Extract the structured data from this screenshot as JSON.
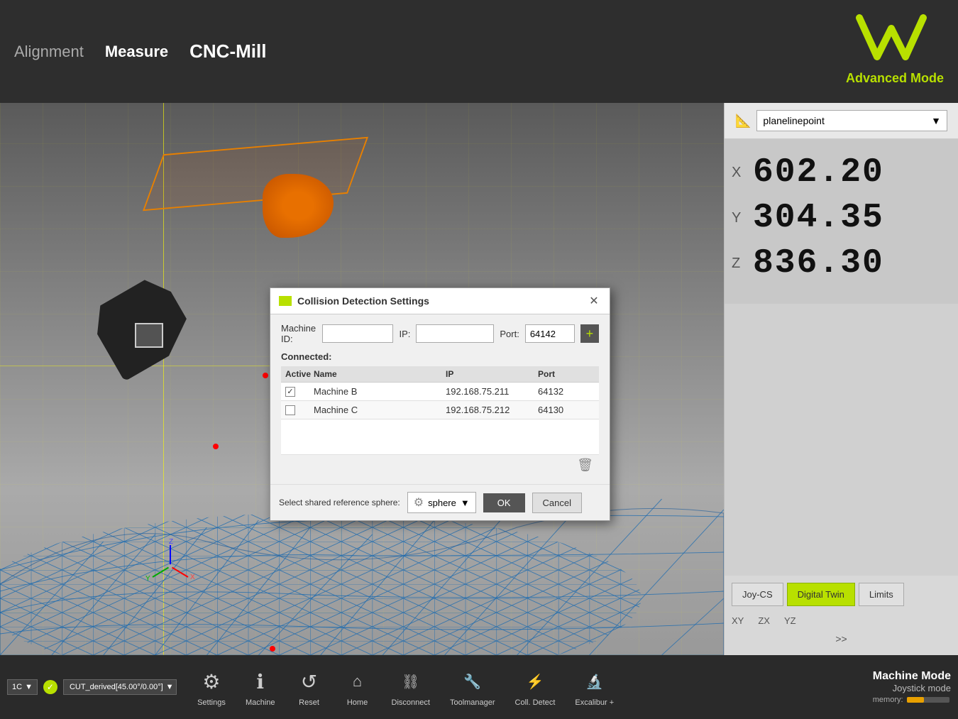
{
  "header": {
    "nav_alignment": "Alignment",
    "nav_measure": "Measure",
    "nav_cnc": "CNC-Mill",
    "advanced_mode_label": "Advanced Mode"
  },
  "right_panel": {
    "dropdown_value": "planelinepoint",
    "coords": {
      "x_label": "X",
      "x_value": "602.20",
      "y_label": "Y",
      "y_value": "304.35",
      "z_label": "Z",
      "z_value": "836.30"
    },
    "btn_joy_cs": "Joy-CS",
    "btn_digital_twin": "Digital Twin",
    "btn_limits": "Limits",
    "coord_xy": "XY",
    "coord_zx": "ZX",
    "coord_yz": "YZ",
    "more": ">>"
  },
  "dialog": {
    "title": "Collision Detection Settings",
    "machine_id_label": "Machine ID:",
    "ip_label": "IP:",
    "port_label": "Port:",
    "port_value": "64142",
    "connected_label": "Connected:",
    "table_headers": {
      "active": "Active",
      "name": "Name",
      "ip": "IP",
      "port": "Port"
    },
    "rows": [
      {
        "active": true,
        "name": "Machine B",
        "ip": "192.168.75.211",
        "port": "64132"
      },
      {
        "active": false,
        "name": "Machine C",
        "ip": "192.168.75.212",
        "port": "64130"
      }
    ],
    "sphere_label": "Select shared reference sphere:",
    "sphere_value": "sphere",
    "ok_label": "OK",
    "cancel_label": "Cancel"
  },
  "bottom_bar": {
    "dropdown_num": "1C",
    "file_name": "CUT_derived[45.00°/0.00°]",
    "settings_label": "Settings",
    "machine_label": "Machine",
    "reset_label": "Reset",
    "home_label": "Home",
    "disconnect_label": "Disconnect",
    "toolmanager_label": "Toolmanager",
    "coll_detect_label": "Coll. Detect",
    "excalibur_label": "Excalibur +",
    "machine_mode_title": "Machine Mode",
    "machine_mode_sub": "Joystick mode",
    "memory_label": "memory:"
  }
}
